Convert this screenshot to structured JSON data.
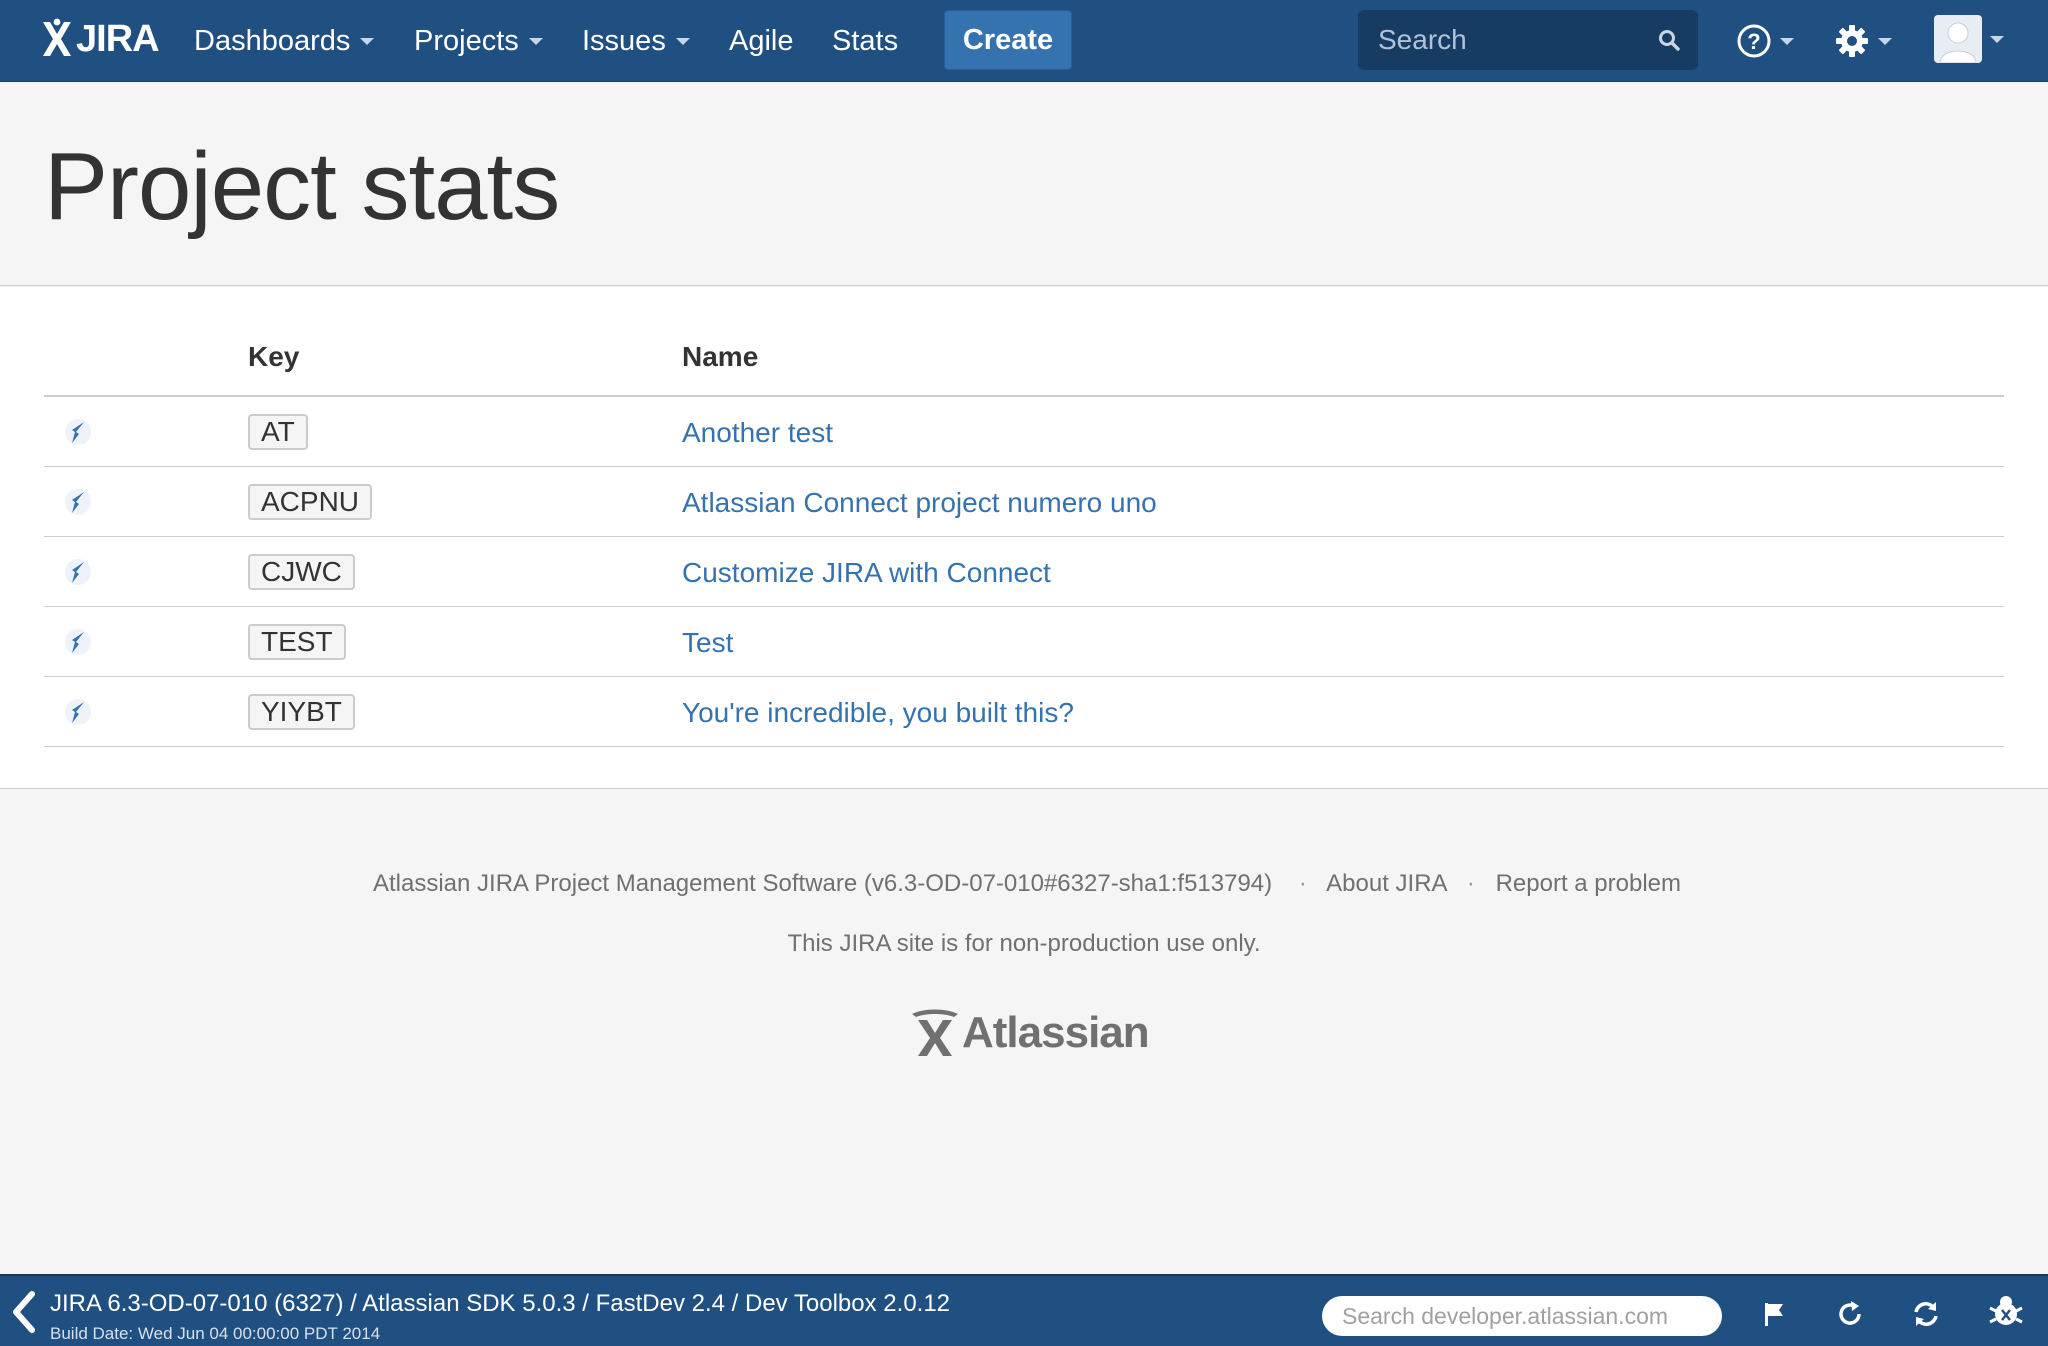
{
  "header": {
    "logo_text": "JIRA",
    "nav": [
      {
        "label": "Dashboards",
        "has_dropdown": true
      },
      {
        "label": "Projects",
        "has_dropdown": true
      },
      {
        "label": "Issues",
        "has_dropdown": true
      },
      {
        "label": "Agile",
        "has_dropdown": false
      },
      {
        "label": "Stats",
        "has_dropdown": false
      }
    ],
    "create_label": "Create",
    "search_placeholder": "Search",
    "icons": [
      "help-icon",
      "gear-icon",
      "user-avatar-icon"
    ]
  },
  "page": {
    "title": "Project stats"
  },
  "table": {
    "columns": [
      "",
      "Key",
      "Name"
    ],
    "rows": [
      {
        "icon": "project-rocket-icon",
        "key": "AT",
        "name": "Another test"
      },
      {
        "icon": "project-rocket-icon",
        "key": "ACPNU",
        "name": "Atlassian Connect project numero uno"
      },
      {
        "icon": "project-rocket-icon",
        "key": "CJWC",
        "name": "Customize JIRA with Connect"
      },
      {
        "icon": "project-rocket-icon",
        "key": "TEST",
        "name": "Test"
      },
      {
        "icon": "project-rocket-icon",
        "key": "YIYBT",
        "name": "You're incredible, you built this?"
      }
    ]
  },
  "footer": {
    "software": "Atlassian JIRA Project Management Software (v6.3-OD-07-010#6327-sha1:f513794)",
    "separator": "·",
    "about_link": "About JIRA",
    "report_link": "Report a problem",
    "notice": "This JIRA site is for non-production use only.",
    "logo_text": "Atlassian"
  },
  "devbar": {
    "title": "JIRA 6.3-OD-07-010 (6327) / Atlassian SDK 5.0.3 / FastDev 2.4 / Dev Toolbox 2.0.12",
    "build_date": "Build Date: Wed Jun 04 00:00:00 PDT 2014",
    "search_placeholder": "Search developer.atlassian.com",
    "icons": [
      "flag-icon",
      "refresh-icon",
      "sync-icon",
      "bug-icon"
    ]
  },
  "colors": {
    "header_bg": "#205081",
    "create_button": "#3572b0",
    "link": "#3572b0",
    "page_bg": "#f5f5f5"
  }
}
